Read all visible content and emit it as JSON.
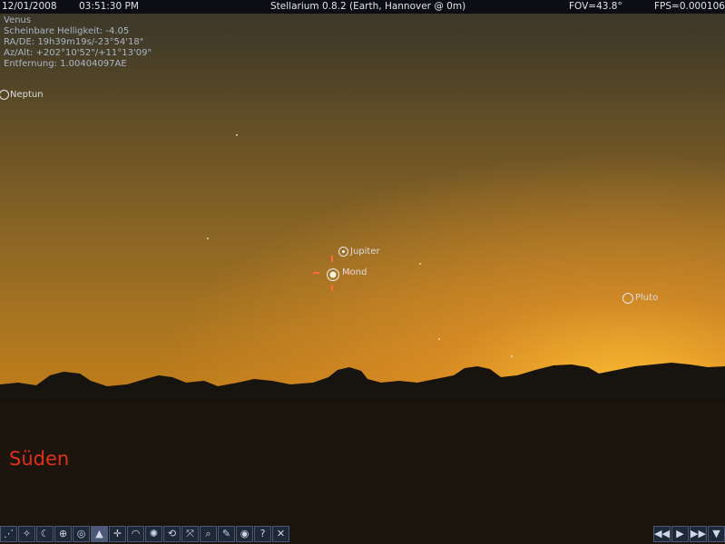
{
  "topbar": {
    "date": "12/01/2008",
    "time": "03:51:30 PM",
    "title": "Stellarium 0.8.2 (Earth, Hannover @ 0m)",
    "fov": "FOV=43.8°",
    "fps": "FPS=0.0001062"
  },
  "selected_object": {
    "name": "Venus",
    "magnitude": "Scheinbare Helligkeit: -4.05",
    "ra_de": "RA/DE: 19h39m19s/-23°54'18\"",
    "az_alt": "Az/Alt: +202°10'52\"/+11°13'09\"",
    "distance": "Entfernung: 1.00404097AE"
  },
  "planets": {
    "neptun": "Neptun",
    "jupiter": "Jupiter",
    "mond": "Mond",
    "pluto": "Pluto"
  },
  "compass": {
    "south": "Süden"
  },
  "toolbar_left": [
    {
      "name": "constellation-lines-button",
      "icon": "⋰"
    },
    {
      "name": "constellation-names-button",
      "icon": "✧"
    },
    {
      "name": "constellation-art-button",
      "icon": "☾"
    },
    {
      "name": "equatorial-grid-button",
      "icon": "⊕"
    },
    {
      "name": "azimuthal-grid-button",
      "icon": "◎"
    },
    {
      "name": "ground-button",
      "icon": "▲"
    },
    {
      "name": "cardinal-points-button",
      "icon": "✛"
    },
    {
      "name": "atmosphere-button",
      "icon": "◠"
    },
    {
      "name": "nebulas-button",
      "icon": "✺"
    },
    {
      "name": "equatorial-mount-button",
      "icon": "⟲"
    },
    {
      "name": "goto-selected-button",
      "icon": "⤧"
    },
    {
      "name": "search-button",
      "icon": "⌕"
    },
    {
      "name": "configuration-button",
      "icon": "✎"
    },
    {
      "name": "night-mode-button",
      "icon": "◉"
    },
    {
      "name": "help-button",
      "icon": "?"
    },
    {
      "name": "quit-button",
      "icon": "✕"
    }
  ],
  "toolbar_right": [
    {
      "name": "rewind-button",
      "icon": "◀◀"
    },
    {
      "name": "play-button",
      "icon": "▶"
    },
    {
      "name": "fast-forward-button",
      "icon": "▶▶"
    },
    {
      "name": "real-time-button",
      "icon": "▼"
    }
  ],
  "colors": {
    "topbar_bg": "#0c0e14",
    "compass_text": "#e0301a",
    "info_text": "#aab6c6",
    "toolbar_bg": "#1e2838"
  }
}
